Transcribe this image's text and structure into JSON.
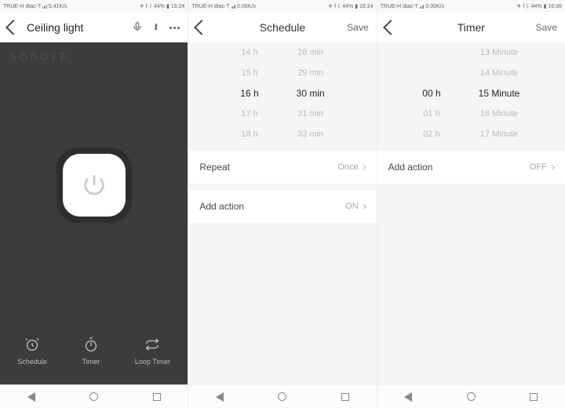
{
  "status": {
    "carrier": "TRUE-H dtac-T",
    "speed1": "5.41K/s",
    "speed0": "0.00K/s",
    "battery": "44%",
    "time_a": "16:24",
    "time_b": "16:36"
  },
  "phone1": {
    "title": "Ceiling light",
    "brand": "SONOFF",
    "tabs": {
      "schedule": "Schedule",
      "timer": "Timer",
      "loop": "Loop Timer"
    }
  },
  "phone2": {
    "title": "Schedule",
    "save": "Save",
    "hours": [
      "14 h",
      "15 h",
      "16 h",
      "17 h",
      "18 h"
    ],
    "mins": [
      "28 min",
      "29 min",
      "30 min",
      "31 min",
      "32 min"
    ],
    "repeat_label": "Repeat",
    "repeat_value": "Once",
    "action_label": "Add action",
    "action_value": "ON"
  },
  "phone3": {
    "title": "Timer",
    "save": "Save",
    "hours": [
      "",
      "",
      "00 h",
      "01 h",
      "02 h"
    ],
    "mins": [
      "13 Minute",
      "14 Minute",
      "15 Minute",
      "16 Minute",
      "17 Minute"
    ],
    "action_label": "Add action",
    "action_value": "OFF"
  }
}
